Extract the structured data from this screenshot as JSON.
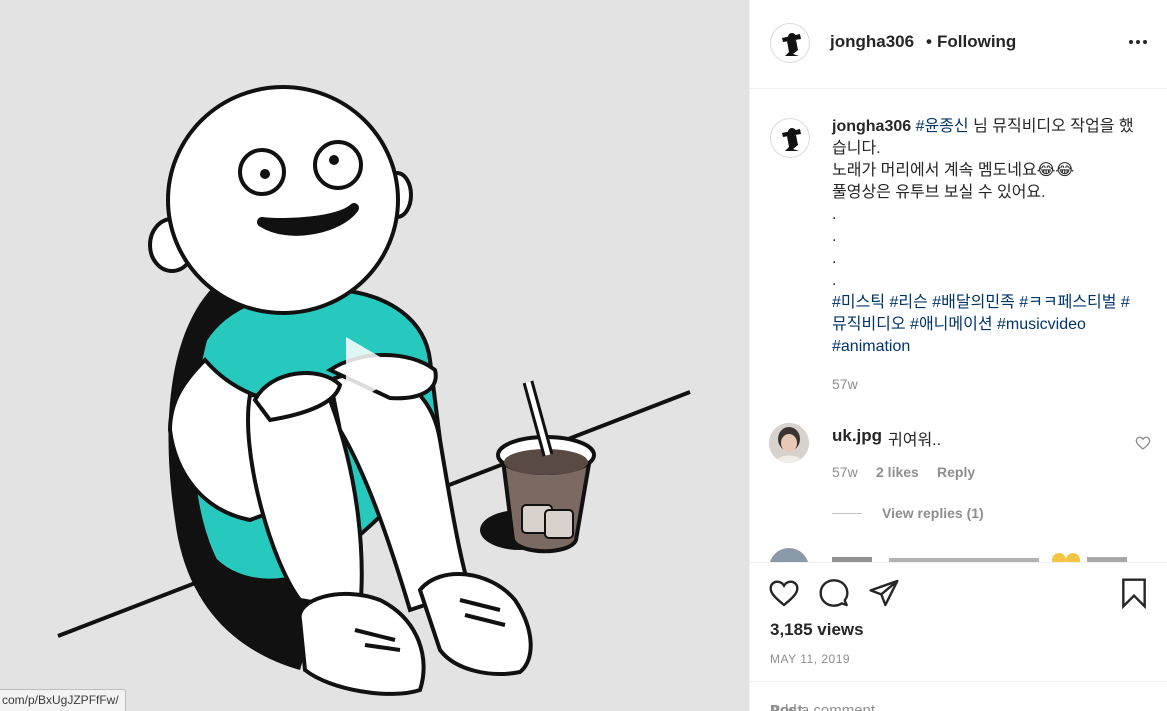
{
  "status_url": "com/p/BxUgJZPFfFw/",
  "post": {
    "username": "jongha306",
    "separator": "•",
    "follow_status": "Following",
    "more_icon": "more-horizontal-icon"
  },
  "caption": {
    "username": "jongha306",
    "line1_tag": "#윤종신",
    "line1_text": " 님 뮤직비디오 작업을 했",
    "line2": "습니다.",
    "line3": "노래가 머리에서 계속 멤도네요😂😂",
    "line4": "풀영상은 유투브 보실 수 있어요.",
    "dots": [
      ".",
      ".",
      ".",
      "."
    ],
    "tags_line1": "#미스틱 #리슨 #배달의민족 #ㅋㅋ페스티벌 #",
    "tags_line2": "뮤직비디오 #애니메이션 #musicvideo",
    "tags_line3": "#animation",
    "time": "57w"
  },
  "comment": {
    "username": "uk.jpg",
    "text": "귀여워..",
    "time": "57w",
    "likes": "2 likes",
    "reply": "Reply",
    "view_replies": "View replies (1)"
  },
  "actions": {
    "views": "3,185 views",
    "date": "MAY 11, 2019",
    "add_comment_placeholder": "Add a comment…",
    "post_label": "Post"
  },
  "colors": {
    "tag": "#003569",
    "meta": "#8e8e8e",
    "shirt": "#27c9bf",
    "video_bg": "#e3e3e3"
  }
}
